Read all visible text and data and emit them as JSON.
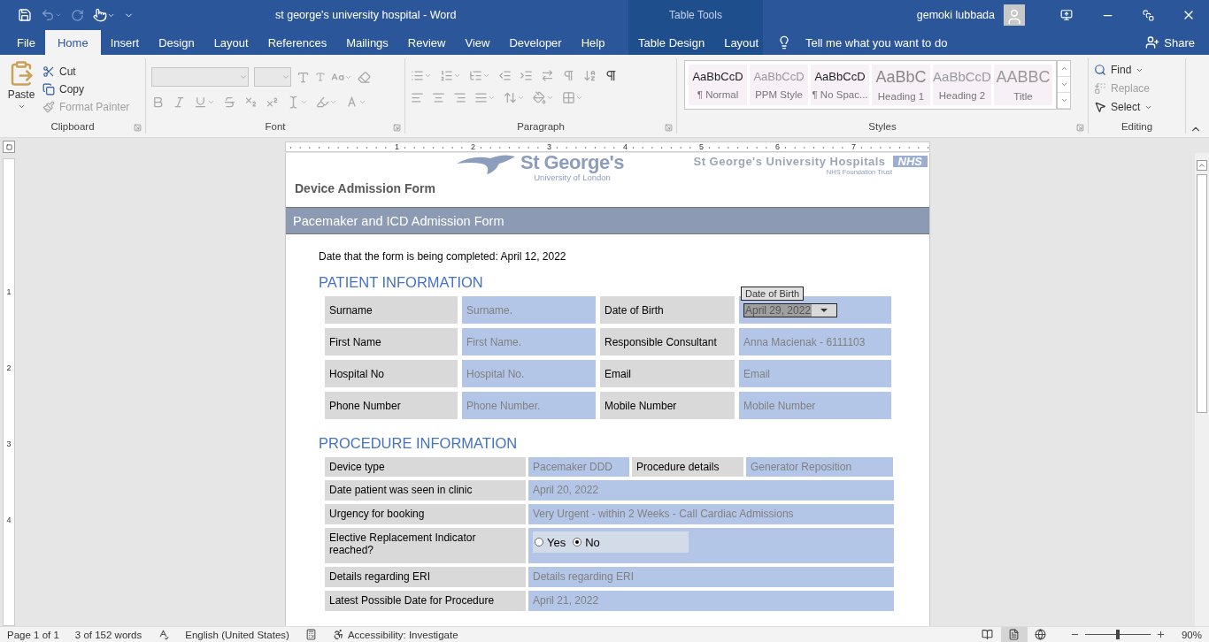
{
  "window": {
    "title": "st george's university hospital  -  Word",
    "context_title": "Table Tools",
    "user": "gemoki lubbada"
  },
  "menu_tabs": [
    {
      "label": "File",
      "selected": false,
      "kind": "main"
    },
    {
      "label": "Home",
      "selected": true,
      "kind": "main"
    },
    {
      "label": "Insert",
      "selected": false,
      "kind": "main"
    },
    {
      "label": "Design",
      "selected": false,
      "kind": "main"
    },
    {
      "label": "Layout",
      "selected": false,
      "kind": "main"
    },
    {
      "label": "References",
      "selected": false,
      "kind": "main"
    },
    {
      "label": "Mailings",
      "selected": false,
      "kind": "main"
    },
    {
      "label": "Review",
      "selected": false,
      "kind": "main"
    },
    {
      "label": "View",
      "selected": false,
      "kind": "main"
    },
    {
      "label": "Developer",
      "selected": false,
      "kind": "main"
    },
    {
      "label": "Help",
      "selected": false,
      "kind": "main"
    },
    {
      "label": "Table Design",
      "selected": false,
      "kind": "context"
    },
    {
      "label": "Layout",
      "selected": false,
      "kind": "context"
    }
  ],
  "tell_me": "Tell me what you want to do",
  "share": "Share",
  "ribbon": {
    "clipboard": {
      "paste": "Paste",
      "items": [
        {
          "kind": "cut",
          "label": "Cut",
          "disabled": false
        },
        {
          "kind": "copy",
          "label": "Copy",
          "disabled": false
        },
        {
          "kind": "painter",
          "label": "Format Painter",
          "disabled": true
        }
      ]
    },
    "groups": [
      "Clipboard",
      "Font",
      "Paragraph",
      "Styles",
      "Editing"
    ],
    "styles": [
      {
        "sample": "AaBbCcD",
        "name": "¶ Normal",
        "kind": "body"
      },
      {
        "sample": "AaBbCcD",
        "name": "PPM Style",
        "kind": "faint"
      },
      {
        "sample": "AaBbCcD",
        "name": "¶ No Spac...",
        "kind": "body"
      },
      {
        "sample": "AaBbC",
        "name": "Heading 1",
        "kind": "heading1"
      },
      {
        "sample": "AaBbCcD",
        "name": "Heading 2",
        "kind": "heading2"
      },
      {
        "sample": "AABBC",
        "name": "Title",
        "kind": "title"
      }
    ],
    "editing": [
      {
        "kind": "find",
        "label": "Find",
        "disabled": false
      },
      {
        "kind": "replace",
        "label": "Replace",
        "disabled": true
      },
      {
        "kind": "select",
        "label": "Select",
        "disabled": false
      }
    ]
  },
  "ruler": [
    "1",
    "2",
    "3",
    "4",
    "5",
    "6",
    "7"
  ],
  "vertical_ruler": [
    "1",
    "2",
    "3",
    "4"
  ],
  "document": {
    "header_title": "Device Admission Form",
    "logo": {
      "name": "St George's",
      "sub": "University of London"
    },
    "trust": {
      "name": "St George's University Hospitals",
      "sub": "NHS Foundation Trust",
      "badge": "NHS"
    },
    "banner": "Pacemaker and ICD Admission Form",
    "date_line": "Date that the form is being completed: April 12, 2022",
    "patient": {
      "heading": "PATIENT INFORMATION",
      "rows": [
        {
          "label": "Surname",
          "value": "Surname.",
          "label2": "Date of Birth",
          "value2": "April 29, 2022",
          "kind": "date_picker",
          "tag2": "Date of Birth"
        },
        {
          "label": "First Name",
          "value": "First Name.",
          "label2": "Responsible Consultant",
          "value2": "Anna Macienak - 6111103",
          "kind": "text"
        },
        {
          "label": "Hospital No",
          "value": "Hospital No.",
          "label2": "Email",
          "value2": "Email",
          "kind": "text"
        },
        {
          "label": "Phone Number",
          "value": "Phone Number.",
          "label2": "Mobile Number",
          "value2": "Mobile Number",
          "kind": "text"
        }
      ]
    },
    "procedure": {
      "heading": "PROCEDURE INFORMATION",
      "rows": [
        {
          "kind": "split",
          "label": "Device type",
          "value": "Pacemaker DDD",
          "label2": "Procedure details",
          "value2": "Generator Reposition"
        },
        {
          "kind": "single",
          "label": "Date patient was seen in clinic",
          "value": "April 20, 2022"
        },
        {
          "kind": "single",
          "label": "Urgency for booking",
          "value": "Very Urgent - within 2 Weeks - Call Cardiac Admissions"
        },
        {
          "kind": "radio",
          "label": "Elective Replacement Indicator reached?",
          "options": [
            {
              "label": "Yes",
              "selected": false
            },
            {
              "label": "No",
              "selected": true
            }
          ]
        },
        {
          "kind": "single",
          "label": "Details regarding ERI",
          "value": "Details regarding ERI"
        },
        {
          "kind": "single",
          "label": "Latest Possible Date for Procedure",
          "value": "April 21, 2022"
        }
      ]
    }
  },
  "status_bar": {
    "page": "Page 1 of 1",
    "words": "3 of 152 words",
    "language": "English (United States)",
    "accessibility": "Accessibility: Investigate",
    "views": [
      {
        "kind": "read",
        "selected": false
      },
      {
        "kind": "print",
        "selected": true
      },
      {
        "kind": "web",
        "selected": false
      }
    ],
    "zoom": {
      "level": 0.5,
      "label": "90%"
    }
  }
}
